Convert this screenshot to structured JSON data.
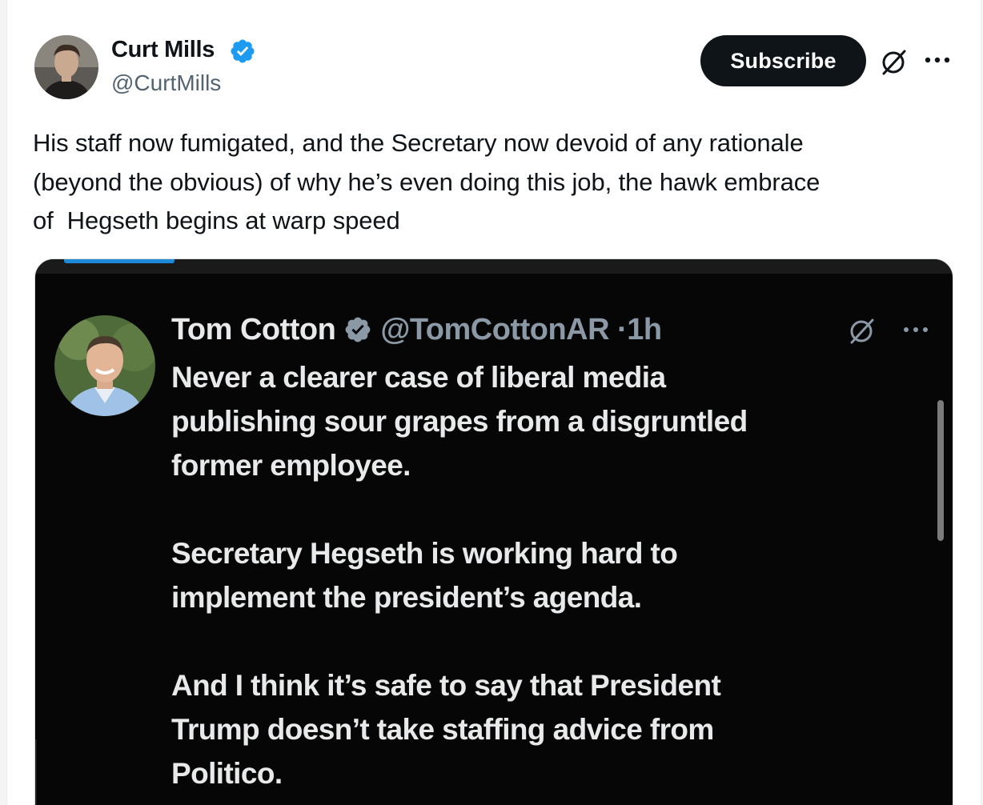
{
  "post": {
    "author": {
      "name": "Curt Mills",
      "handle": "@CurtMills",
      "verified": true,
      "avatar_icon": "avatar-photo"
    },
    "actions": {
      "subscribe_label": "Subscribe",
      "grok_icon": "grok-icon",
      "more_icon": "more-horizontal-icon"
    },
    "text": "His staff now fumigated, and the Secretary now devoid of any rationale\n(beyond the obvious) of why he’s even doing this job, the hawk embrace\nof  Hegseth begins at warp speed"
  },
  "embedded_screenshot": {
    "author": {
      "name": "Tom Cotton",
      "handle": "@TomCottonAR",
      "separator": "·",
      "time": "1h",
      "verified": true
    },
    "text": "Never a clearer case of liberal media\npublishing sour grapes from a disgruntled\nformer employee.\n\nSecretary Hegseth is working hard to\nimplement the president’s agenda.\n\nAnd I think it’s safe to say that President\nTrump doesn’t take staffing advice from\nPolitico."
  },
  "colors": {
    "verified_blue": "#1d9bf0",
    "text_primary": "#0f1419",
    "text_secondary": "#536471",
    "dark_bg": "#060606",
    "dark_text": "#e7e9ea"
  }
}
